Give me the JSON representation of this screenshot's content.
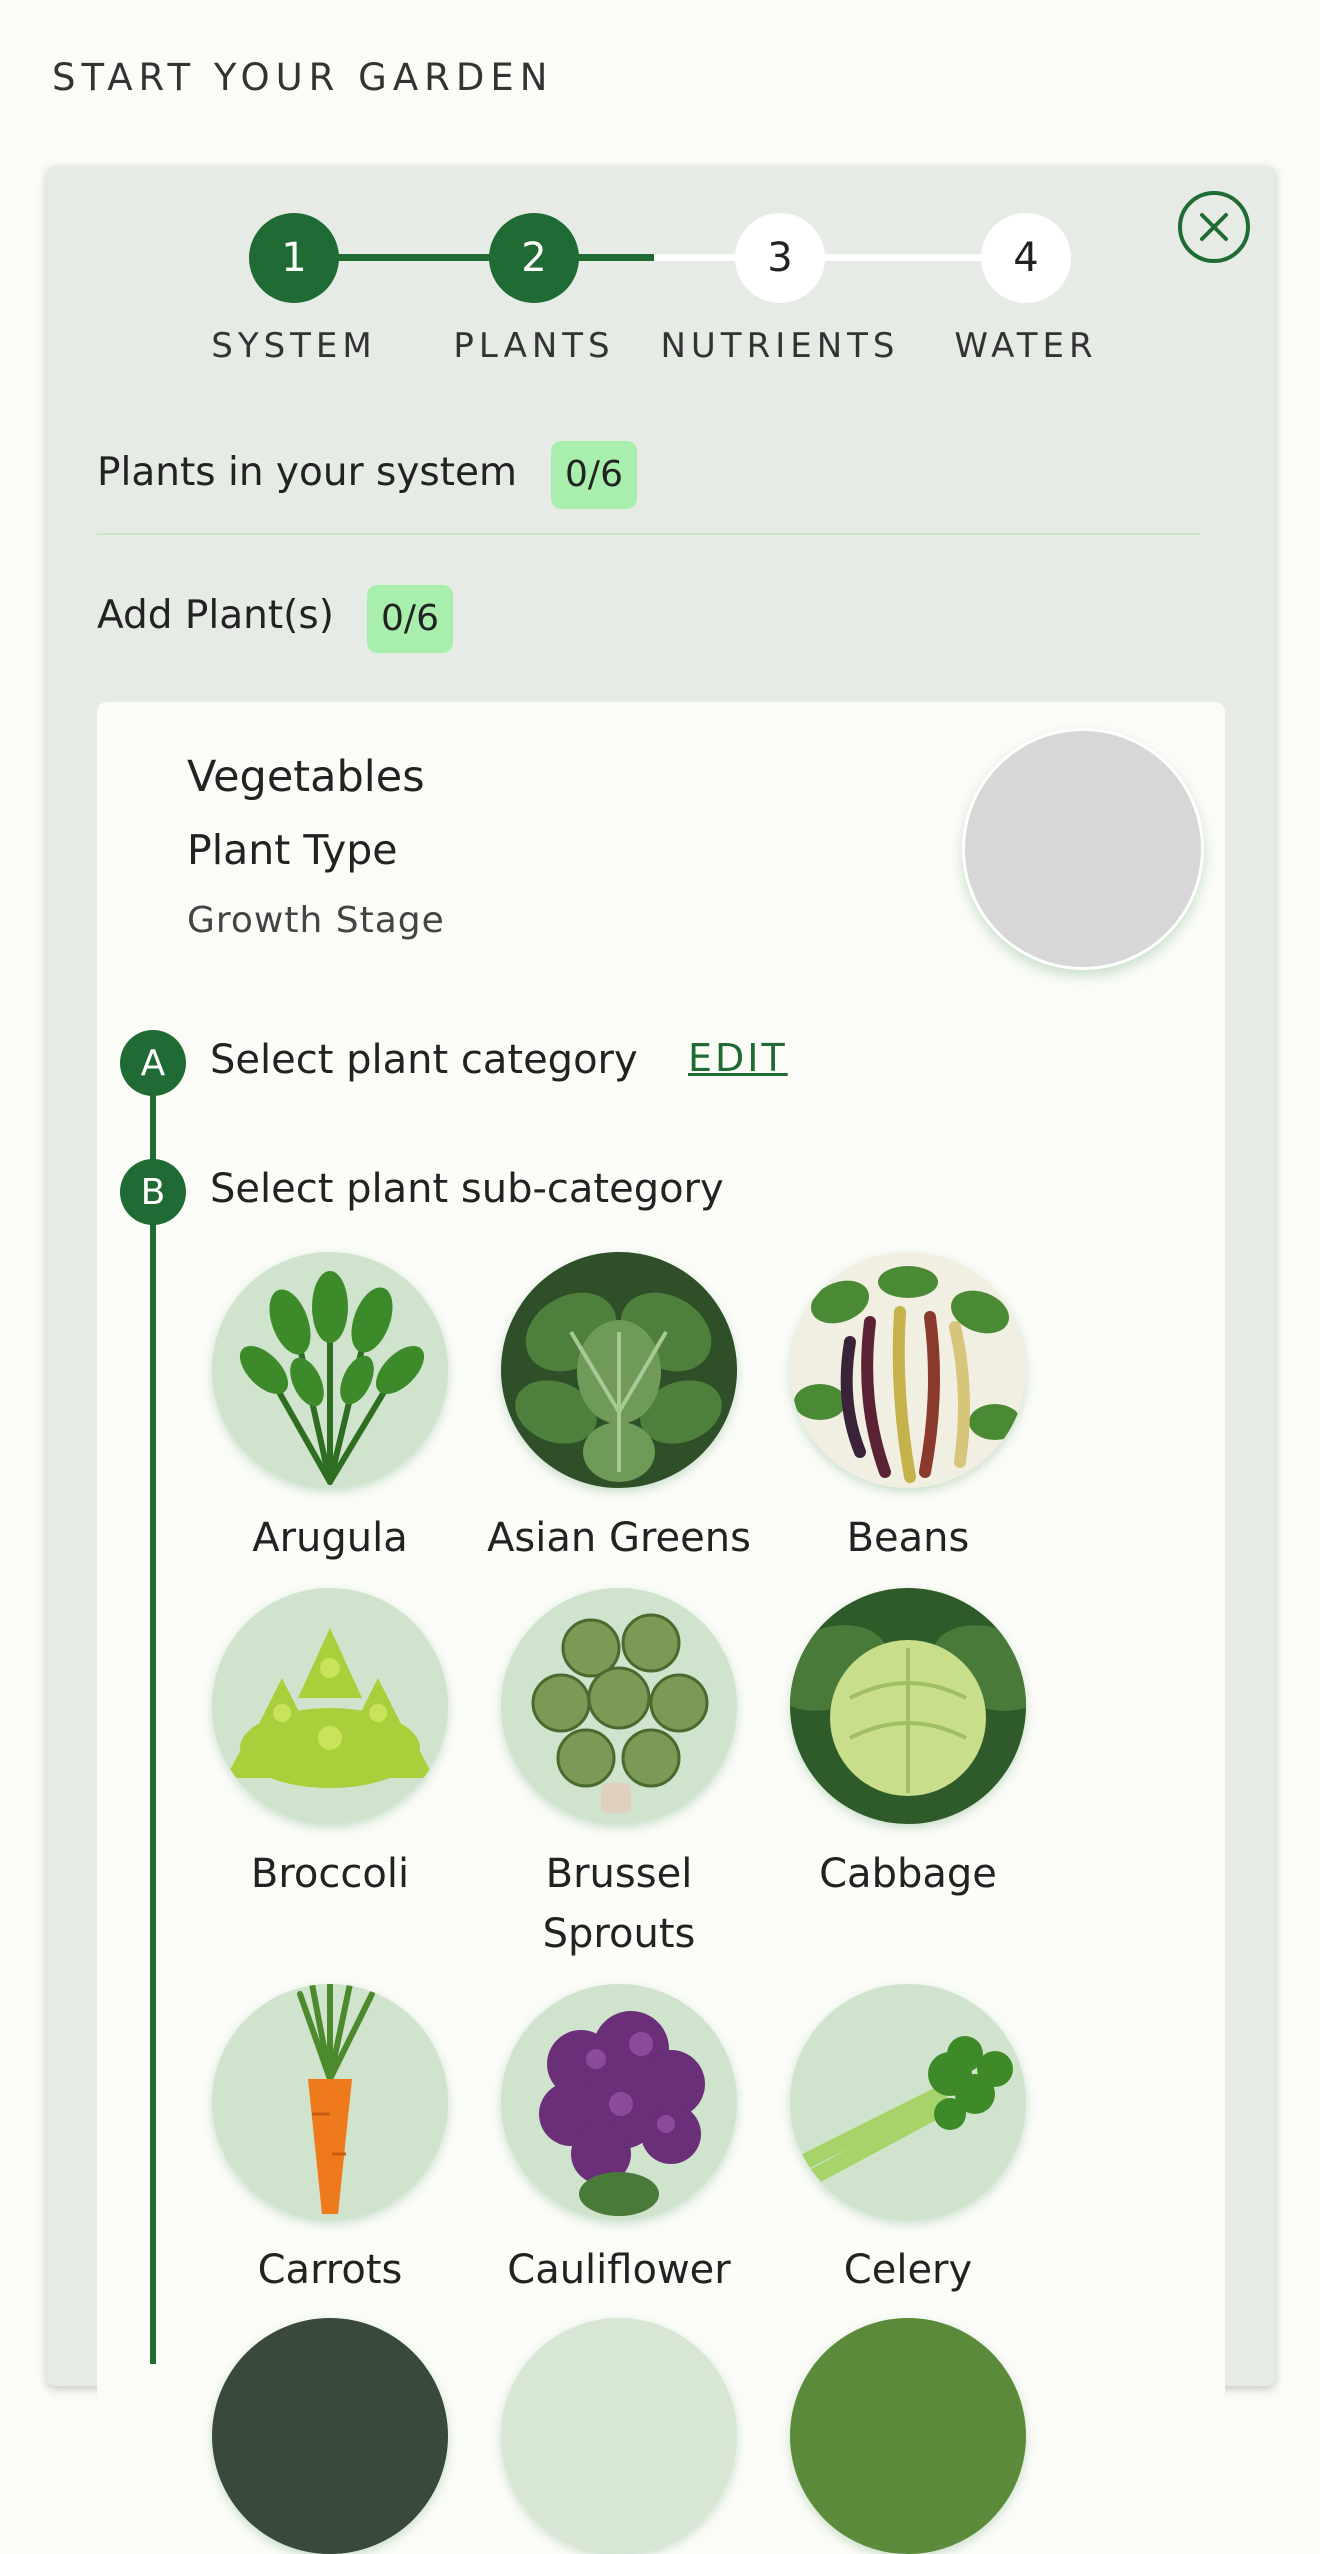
{
  "page": {
    "title": "START YOUR GARDEN"
  },
  "stepper": {
    "steps": [
      {
        "number": "1",
        "label": "SYSTEM"
      },
      {
        "number": "2",
        "label": "PLANTS"
      },
      {
        "number": "3",
        "label": "NUTRIENTS"
      },
      {
        "number": "4",
        "label": "WATER"
      }
    ],
    "current_step": 2
  },
  "summary": {
    "plants_label": "Plants in your system",
    "plants_count": "0/6",
    "add_label": "Add Plant(s)",
    "add_count": "0/6"
  },
  "plant_card": {
    "category": "Vegetables",
    "plant_type": "Plant Type",
    "growth_stage": "Growth Stage"
  },
  "wizard": {
    "step_a": {
      "marker": "A",
      "text": "Select plant category",
      "edit_label": "EDIT"
    },
    "step_b": {
      "marker": "B",
      "text": "Select plant sub-category"
    }
  },
  "subcategories": [
    {
      "name": "Arugula",
      "icon": "arugula-image"
    },
    {
      "name": "Asian Greens",
      "icon": "asian-greens-image"
    },
    {
      "name": "Beans",
      "icon": "beans-image"
    },
    {
      "name": "Broccoli",
      "icon": "broccoli-image"
    },
    {
      "name": "Brussel Sprouts",
      "icon": "brussel-sprouts-image"
    },
    {
      "name": "Cabbage",
      "icon": "cabbage-image"
    },
    {
      "name": "Carrots",
      "icon": "carrots-image"
    },
    {
      "name": "Cauliflower",
      "icon": "cauliflower-image"
    },
    {
      "name": "Celery",
      "icon": "celery-image"
    }
  ],
  "colors": {
    "accent": "#1f6b33",
    "badge": "#a8efad",
    "panel": "#e6ece5",
    "page": "#fbfcf8"
  }
}
